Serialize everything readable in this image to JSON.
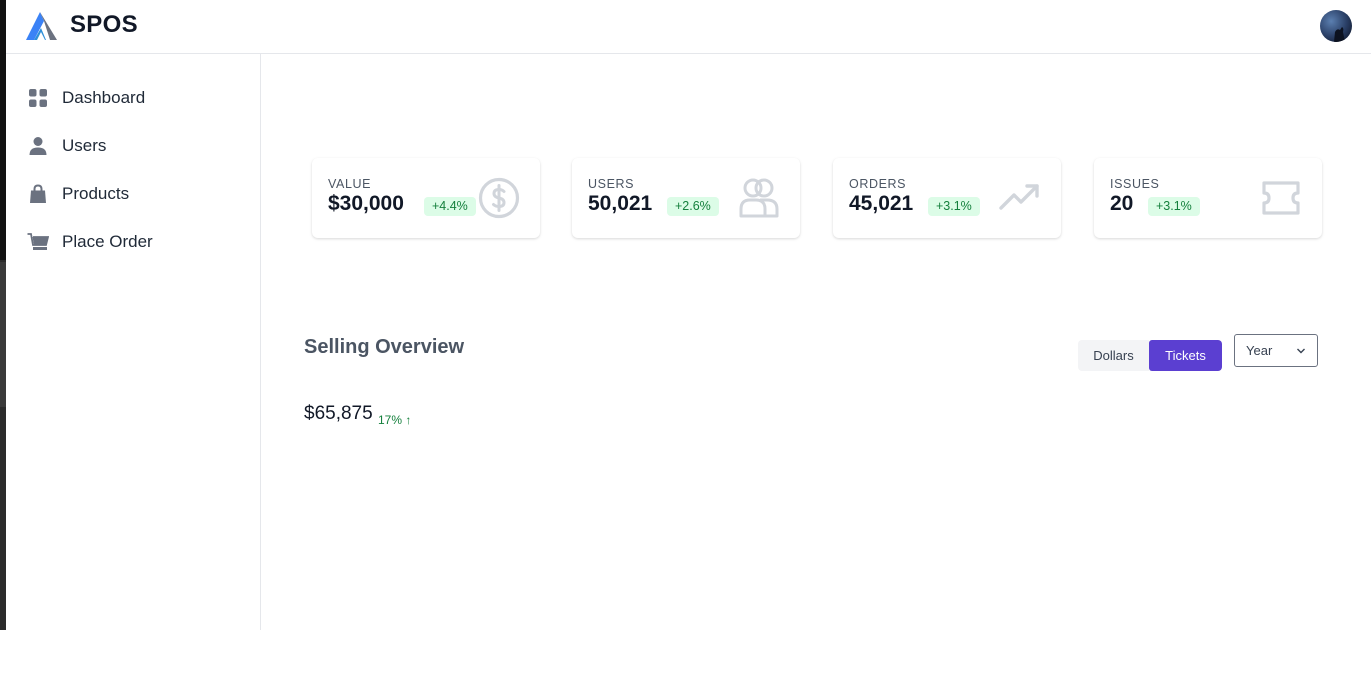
{
  "app": {
    "brand": "SPOS"
  },
  "colors": {
    "accent": "#5b3fd1",
    "badge_bg": "#dcfce7",
    "badge_text": "#15803d",
    "icon_gray": "#d1d5db"
  },
  "sidebar": {
    "items": [
      {
        "label": "Dashboard",
        "icon": "grid-icon"
      },
      {
        "label": "Users",
        "icon": "user-icon"
      },
      {
        "label": "Products",
        "icon": "shopping-bag-icon"
      },
      {
        "label": "Place Order",
        "icon": "cart-icon"
      }
    ]
  },
  "stats": [
    {
      "label": "VALUE",
      "value": "$30,000",
      "change": "+4.4%",
      "icon": "dollar-circle-icon"
    },
    {
      "label": "USERS",
      "value": "50,021",
      "change": "+2.6%",
      "icon": "users-icon"
    },
    {
      "label": "ORDERS",
      "value": "45,021",
      "change": "+3.1%",
      "icon": "trending-up-icon"
    },
    {
      "label": "ISSUES",
      "value": "20",
      "change": "+3.1%",
      "icon": "ticket-icon"
    }
  ],
  "overview": {
    "title": "Selling Overview",
    "toggle": {
      "options": [
        "Dollars",
        "Tickets"
      ],
      "selected": "Tickets"
    },
    "period": {
      "selected": "Year"
    },
    "total": "$65,875",
    "change": "17% ↑"
  }
}
